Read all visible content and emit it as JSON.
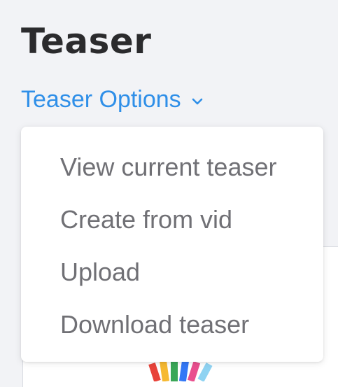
{
  "header": {
    "title": "Teaser"
  },
  "options": {
    "toggle_label": "Teaser Options",
    "toggle_icon": "chevron-down-icon",
    "accent_color": "#2f8fe8",
    "menu_items": [
      {
        "label": "View current teaser"
      },
      {
        "label": "Create from vid"
      },
      {
        "label": "Upload"
      },
      {
        "label": "Download teaser"
      }
    ]
  }
}
